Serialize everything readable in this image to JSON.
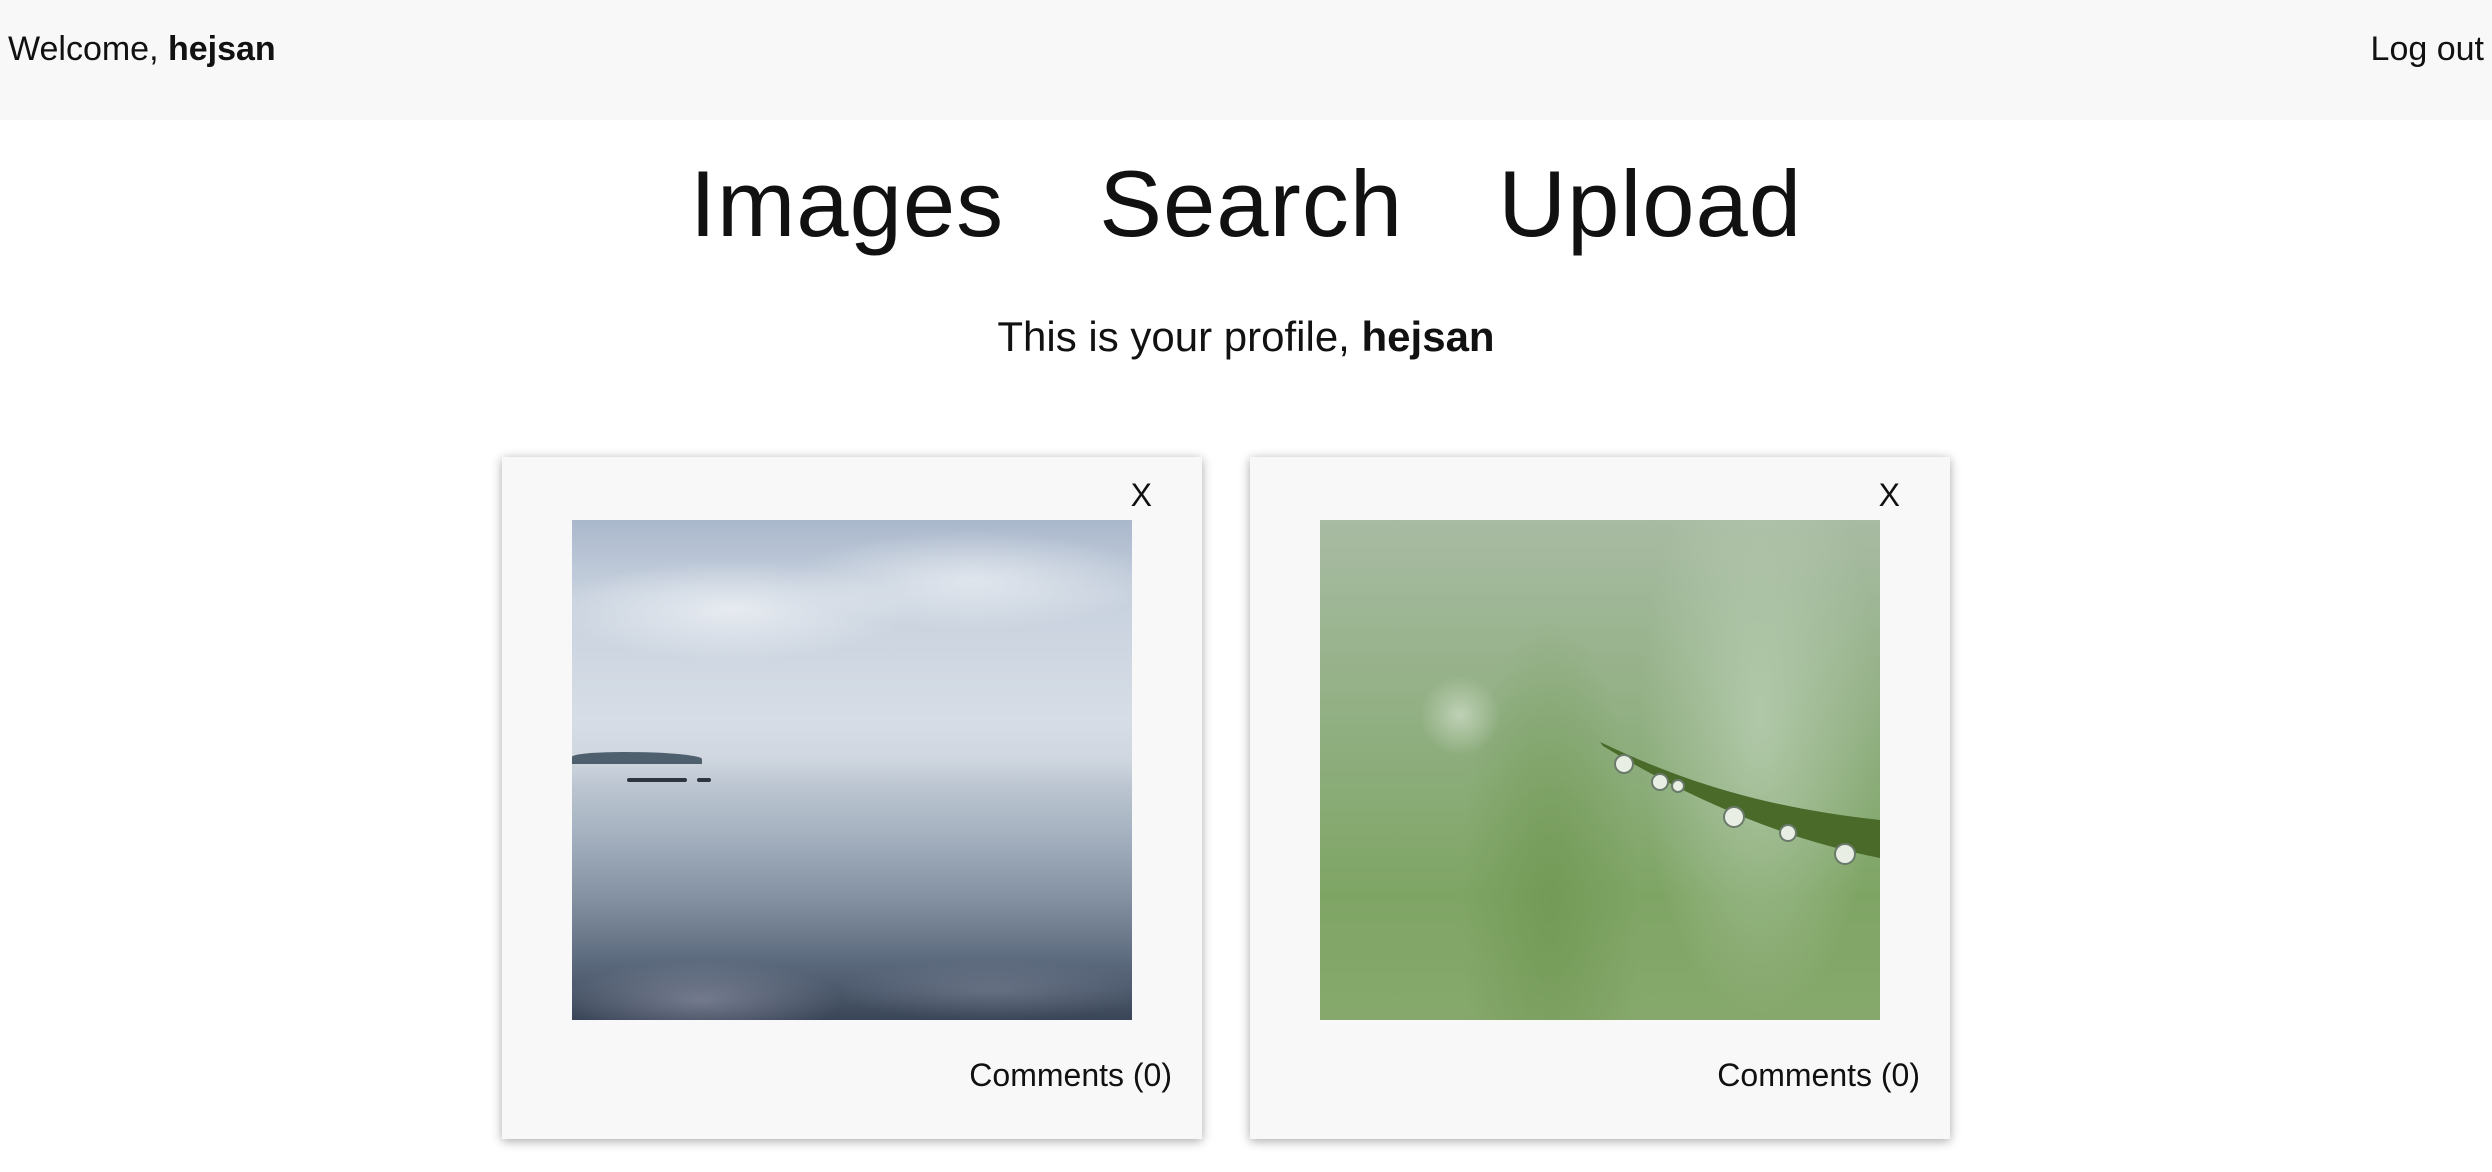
{
  "header": {
    "welcome_prefix": "Welcome,",
    "username": "hejsan",
    "logout_label": "Log out"
  },
  "nav": {
    "items": [
      {
        "label": "Images"
      },
      {
        "label": "Search"
      },
      {
        "label": "Upload"
      }
    ]
  },
  "profile": {
    "prefix": "This is your profile,",
    "username": "hejsan"
  },
  "cards": [
    {
      "close_label": "X",
      "photo": "sea-landscape",
      "comments_label": "Comments (0)"
    },
    {
      "close_label": "X",
      "photo": "leaf-dewdrops",
      "comments_label": "Comments (0)"
    }
  ],
  "colors": {
    "topbar_bg": "#f8f8f8",
    "card_bg": "#f8f8f8",
    "text": "#111111"
  }
}
